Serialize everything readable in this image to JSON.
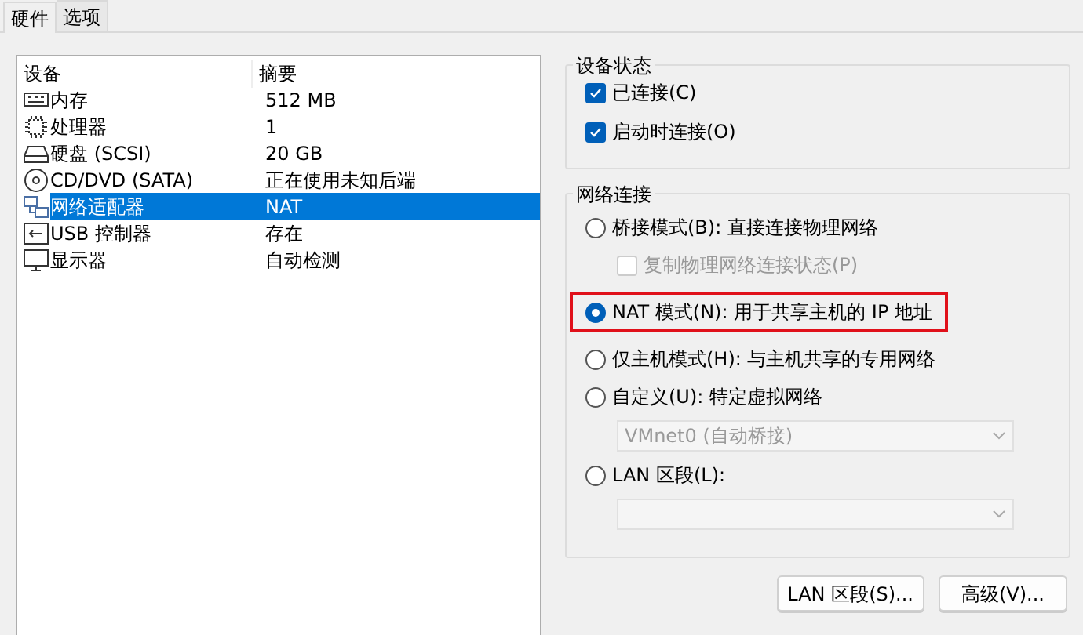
{
  "tabs": [
    {
      "label": "硬件",
      "selected": true
    },
    {
      "label": "选项",
      "selected": false
    }
  ],
  "devices": {
    "columns": [
      "设备",
      "摘要"
    ],
    "rows": [
      {
        "kind": "memory",
        "name": "内存",
        "summary": "512 MB",
        "selected": false
      },
      {
        "kind": "cpu",
        "name": "处理器",
        "summary": "1",
        "selected": false
      },
      {
        "kind": "disk",
        "name": "硬盘 (SCSI)",
        "summary": "20 GB",
        "selected": false
      },
      {
        "kind": "cdrom",
        "name": "CD/DVD (SATA)",
        "summary": "正在使用未知后端",
        "selected": false
      },
      {
        "kind": "network",
        "name": "网络适配器",
        "summary": "NAT",
        "selected": true
      },
      {
        "kind": "usb",
        "name": "USB 控制器",
        "summary": "存在",
        "selected": false
      },
      {
        "kind": "display",
        "name": "显示器",
        "summary": "自动检测",
        "selected": false
      }
    ]
  },
  "device_status": {
    "title": "设备状态",
    "items": [
      {
        "label": "已连接(C)",
        "checked": true
      },
      {
        "label": "启动时连接(O)",
        "checked": true
      }
    ]
  },
  "network_connection": {
    "title": "网络连接",
    "items": [
      {
        "kind": "radio",
        "label": "桥接模式(B): 直接连接物理网络",
        "selected": false,
        "highlighted": false
      },
      {
        "kind": "checkbox",
        "label": "复制物理网络连接状态(P)",
        "checked": false,
        "disabled": true
      },
      {
        "kind": "radio",
        "label": "NAT 模式(N): 用于共享主机的 IP 地址",
        "selected": true,
        "highlighted": true
      },
      {
        "kind": "radio",
        "label": "仅主机模式(H): 与主机共享的专用网络",
        "selected": false,
        "highlighted": false
      },
      {
        "kind": "radio",
        "label": "自定义(U): 特定虚拟网络",
        "selected": false,
        "highlighted": false
      },
      {
        "kind": "select",
        "value": "VMnet0 (自动桥接)",
        "disabled": true
      },
      {
        "kind": "radio",
        "label": "LAN 区段(L):",
        "selected": false,
        "highlighted": false
      },
      {
        "kind": "select",
        "disabled": true
      }
    ]
  },
  "buttons": [
    "LAN 区段(S)...",
    "高级(V)..."
  ]
}
